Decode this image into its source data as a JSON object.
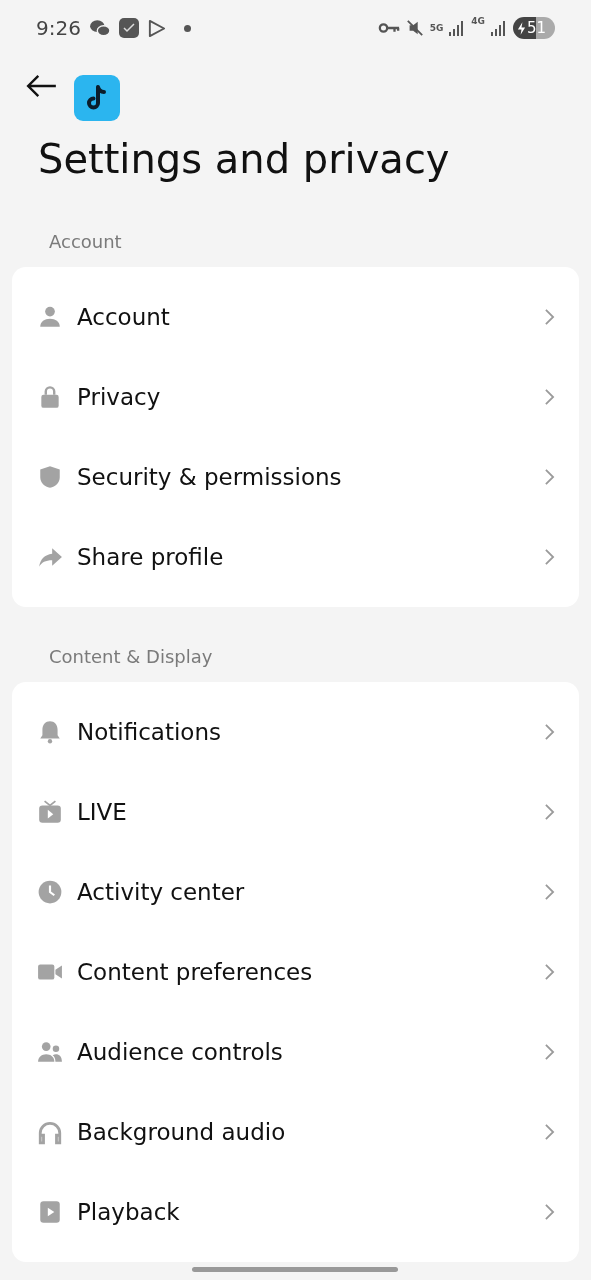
{
  "status_bar": {
    "time": "9:26",
    "network_5g": "5G",
    "network_4g": "4G",
    "battery": "51"
  },
  "header": {
    "title": "Settings and privacy"
  },
  "sections": [
    {
      "title": "Account",
      "items": [
        {
          "label": "Account"
        },
        {
          "label": "Privacy"
        },
        {
          "label": "Security & permissions"
        },
        {
          "label": "Share profile"
        }
      ]
    },
    {
      "title": "Content & Display",
      "items": [
        {
          "label": "Notifications"
        },
        {
          "label": "LIVE"
        },
        {
          "label": "Activity center"
        },
        {
          "label": "Content preferences"
        },
        {
          "label": "Audience controls"
        },
        {
          "label": "Background audio"
        },
        {
          "label": "Playback"
        }
      ]
    }
  ]
}
